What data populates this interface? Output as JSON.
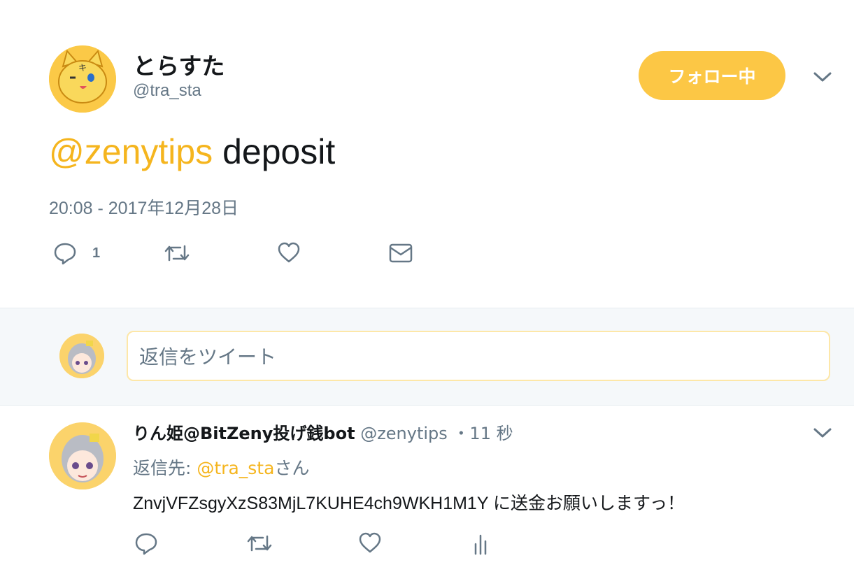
{
  "main_tweet": {
    "display_name": "とらすた",
    "handle": "@tra_sta",
    "follow_label": "フォロー中",
    "mention": "@zenytips",
    "text": " deposit",
    "timestamp": "20:08 - 2017年12月28日",
    "reply_count": "1",
    "icons": [
      "reply-icon",
      "retweet-icon",
      "like-icon",
      "dm-icon"
    ]
  },
  "reply_box": {
    "placeholder": "返信をツイート"
  },
  "reply_tweet": {
    "display_name": "りん姫@BitZeny投げ銭bot",
    "handle": "@zenytips",
    "separator": "・",
    "time": "11 秒",
    "reply_to_prefix": "返信先: ",
    "reply_to_mention": "@tra_sta",
    "reply_to_suffix": "さん",
    "text": "ZnvjVFZsgyXzS83MjL7KUHE4ch9WKH1M1Y に送金お願いしますっ！",
    "icons": [
      "reply-icon",
      "retweet-icon",
      "like-icon",
      "analytics-icon"
    ]
  },
  "colors": {
    "accent": "#f5b51e",
    "follow_button": "#fcc745",
    "secondary_text": "#657786"
  }
}
